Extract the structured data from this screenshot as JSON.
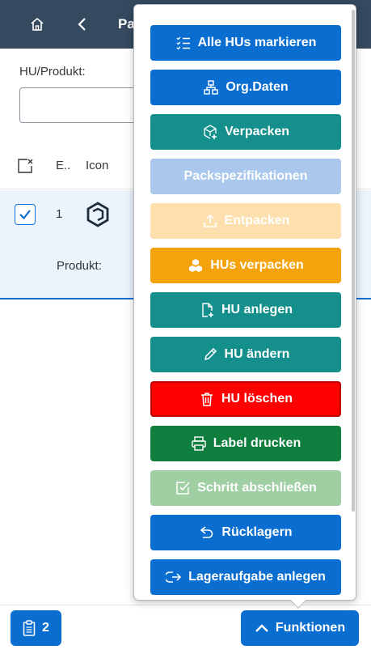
{
  "header": {
    "title": "Pa"
  },
  "filter": {
    "label": "HU/Produkt:",
    "value": ""
  },
  "table": {
    "columns": [
      "E..",
      "Icon"
    ],
    "rows": [
      {
        "number": "1",
        "product_label": "Produkt:"
      }
    ]
  },
  "footer": {
    "count_label": "2",
    "functions_label": "Funktionen"
  },
  "menu": {
    "items": [
      {
        "label": "Alle HUs markieren",
        "icon": "list-check-icon",
        "color": "#0a6ed1"
      },
      {
        "label": "Org.Daten",
        "icon": "org-chart-icon",
        "color": "#0a6ed1"
      },
      {
        "label": "Verpacken",
        "icon": "package-add-icon",
        "color": "#148f8b"
      },
      {
        "label": "Packspezifikationen",
        "icon": "",
        "color": "#a9c8ec"
      },
      {
        "label": "Entpacken",
        "icon": "upload-icon",
        "color": "#fde0ae"
      },
      {
        "label": "HUs verpacken",
        "icon": "cubes-icon",
        "color": "#f4a30c"
      },
      {
        "label": "HU anlegen",
        "icon": "document-add-icon",
        "color": "#148f8b"
      },
      {
        "label": "HU ändern",
        "icon": "pencil-icon",
        "color": "#148f8b"
      },
      {
        "label": "HU löschen",
        "icon": "trash-icon",
        "color": "#ff0000"
      },
      {
        "label": "Label drucken",
        "icon": "printer-icon",
        "color": "#107e3e"
      },
      {
        "label": "Schritt abschließen",
        "icon": "checkbox-icon",
        "color": "#a0cfa4"
      },
      {
        "label": "Rücklagern",
        "icon": "undo-icon",
        "color": "#0a6ed1"
      },
      {
        "label": "Lageraufgabe anlegen",
        "icon": "exit-icon",
        "color": "#0a6ed1"
      }
    ]
  }
}
